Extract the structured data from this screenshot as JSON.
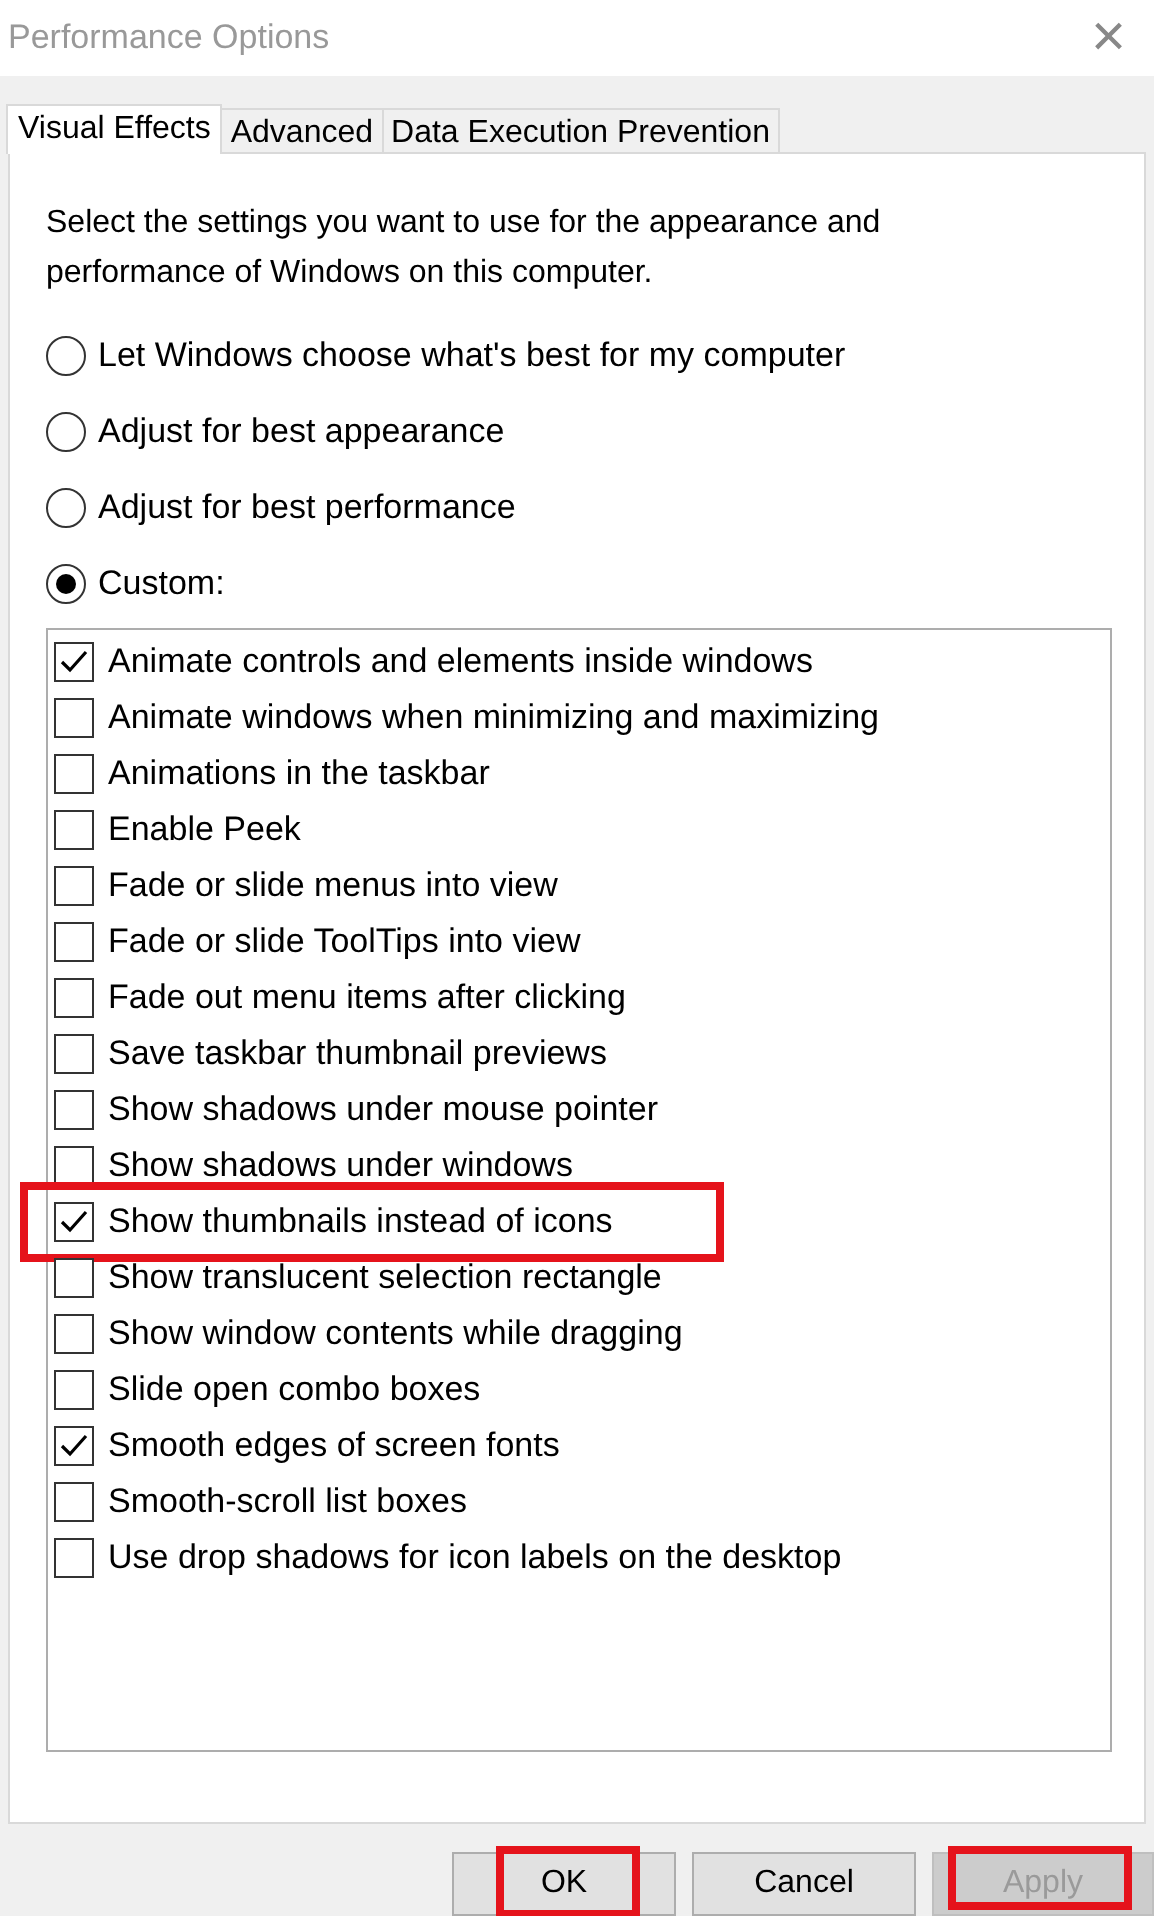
{
  "window": {
    "title": "Performance Options",
    "close": "×"
  },
  "tabs": [
    {
      "label": "Visual Effects",
      "selected": true
    },
    {
      "label": "Advanced",
      "selected": false
    },
    {
      "label": "Data Execution Prevention",
      "selected": false
    }
  ],
  "description": "Select the settings you want to use for the appearance and performance of Windows on this computer.",
  "options": [
    {
      "label": "Let Windows choose what's best for my computer",
      "selected": false
    },
    {
      "label": "Adjust for best appearance",
      "selected": false
    },
    {
      "label": "Adjust for best performance",
      "selected": false
    },
    {
      "label": "Custom:",
      "selected": true
    }
  ],
  "effects": [
    {
      "label": "Animate controls and elements inside windows",
      "checked": true,
      "highlighted": false
    },
    {
      "label": "Animate windows when minimizing and maximizing",
      "checked": false,
      "highlighted": false
    },
    {
      "label": "Animations in the taskbar",
      "checked": false,
      "highlighted": false
    },
    {
      "label": "Enable Peek",
      "checked": false,
      "highlighted": false
    },
    {
      "label": "Fade or slide menus into view",
      "checked": false,
      "highlighted": false
    },
    {
      "label": "Fade or slide ToolTips into view",
      "checked": false,
      "highlighted": false
    },
    {
      "label": "Fade out menu items after clicking",
      "checked": false,
      "highlighted": false
    },
    {
      "label": "Save taskbar thumbnail previews",
      "checked": false,
      "highlighted": false
    },
    {
      "label": "Show shadows under mouse pointer",
      "checked": false,
      "highlighted": false
    },
    {
      "label": "Show shadows under windows",
      "checked": false,
      "highlighted": false
    },
    {
      "label": "Show thumbnails instead of icons",
      "checked": true,
      "highlighted": true
    },
    {
      "label": "Show translucent selection rectangle",
      "checked": false,
      "highlighted": false
    },
    {
      "label": "Show window contents while dragging",
      "checked": false,
      "highlighted": false
    },
    {
      "label": "Slide open combo boxes",
      "checked": false,
      "highlighted": false
    },
    {
      "label": "Smooth edges of screen fonts",
      "checked": true,
      "highlighted": false
    },
    {
      "label": "Smooth-scroll list boxes",
      "checked": false,
      "highlighted": false
    },
    {
      "label": "Use drop shadows for icon labels on the desktop",
      "checked": false,
      "highlighted": false
    }
  ],
  "buttons": [
    {
      "label": "OK",
      "disabled": false,
      "highlighted": true
    },
    {
      "label": "Cancel",
      "disabled": false,
      "highlighted": false
    },
    {
      "label": "Apply",
      "disabled": true,
      "highlighted": true
    }
  ]
}
